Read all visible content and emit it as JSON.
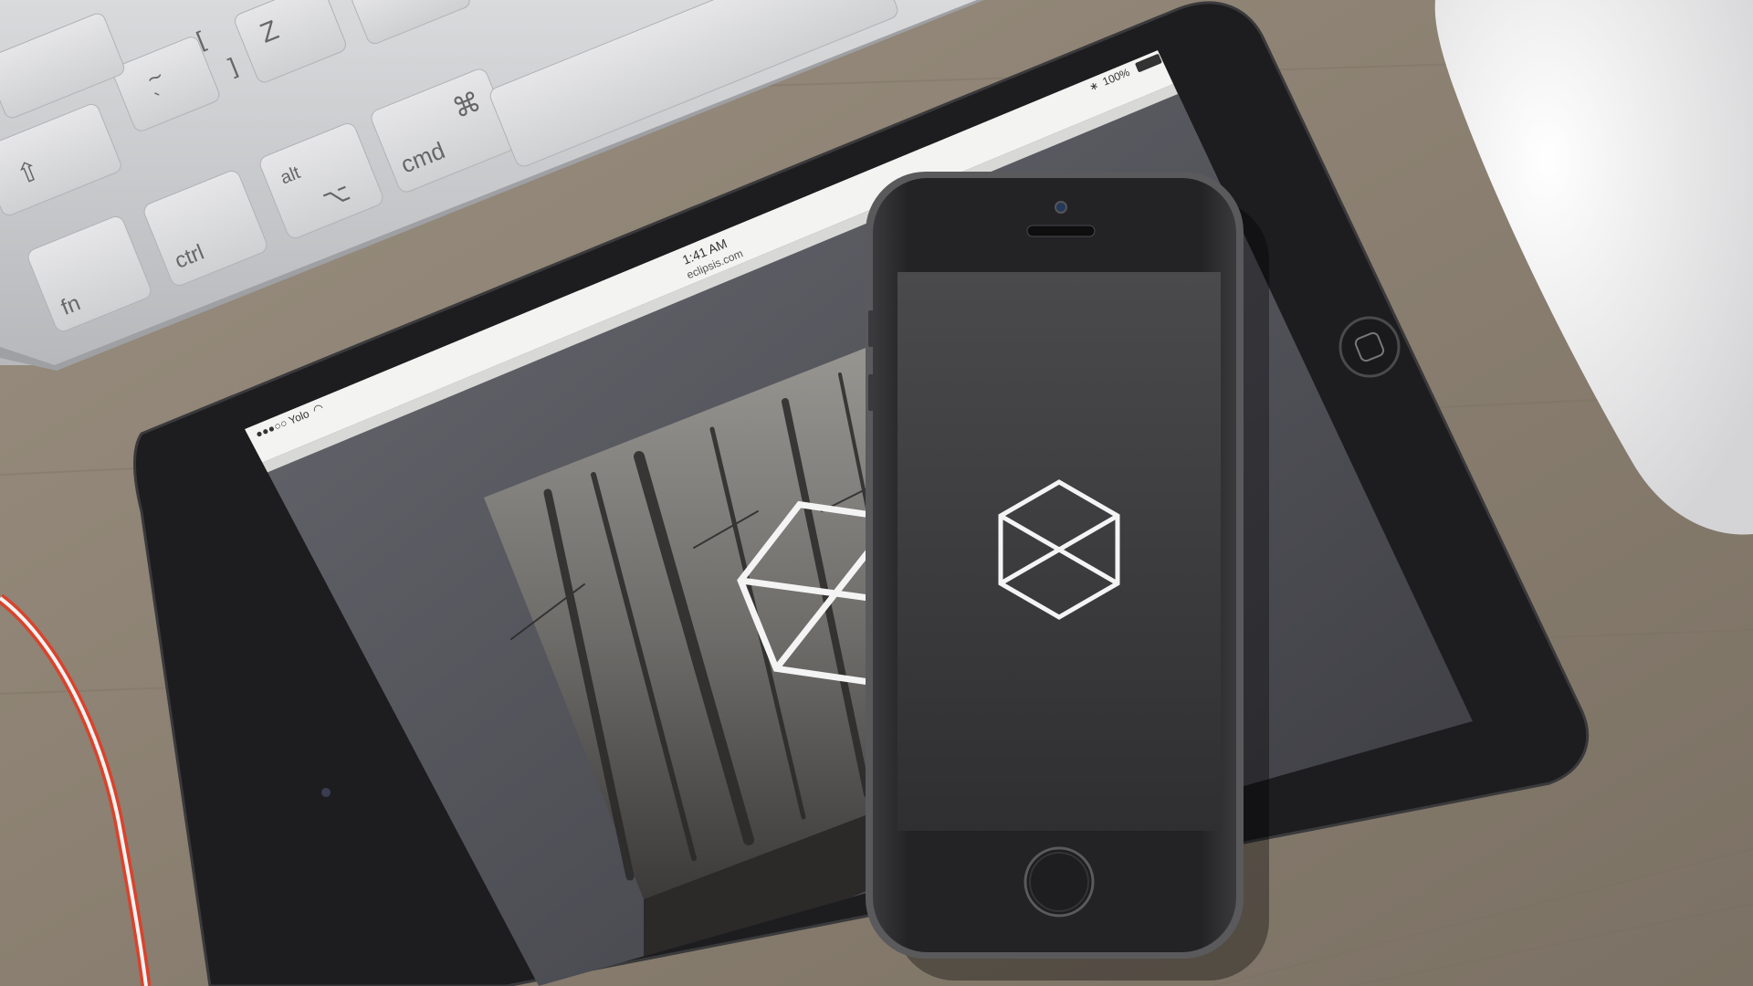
{
  "colors": {
    "desk": "#8e8272",
    "desk_dark": "#6f655a",
    "keyboard_body": "#c9cacc",
    "key_cap": "#dcdcde",
    "tablet_bezel": "#1f1f21",
    "tablet_screen": "#54545b",
    "phone_body": "#262628",
    "phone_screen": "#414143",
    "status_bar": "#f1f1ef",
    "cable": "#e0452f",
    "mouse": "#eeeeee",
    "logo_stroke": "#f4f4f4"
  },
  "keyboard": {
    "keys": {
      "shift": "⇧",
      "fn": "fn",
      "ctrl": "ctrl",
      "alt_top": "alt",
      "alt_bottom": "⌥",
      "cmd_label": "cmd",
      "cmd_symbol": "⌘",
      "tilde_top": "~",
      "tilde_bottom": "`",
      "z": "Z",
      "bracket_open": "[",
      "bracket_close": "]"
    }
  },
  "tablet": {
    "status_bar": {
      "carrier": "●●●○○ Yolo",
      "wifi_icon": "wifi-icon",
      "bluetooth": "∗",
      "battery_percent": "100%"
    },
    "address_bar": {
      "time": "1:41 AM",
      "url": "eclipsis.com"
    },
    "hero": {
      "image": "foggy-forest-photo",
      "logo": "hexagon-cross-logo-icon"
    }
  },
  "phone": {
    "screen": {
      "logo": "hexagon-cross-logo-icon"
    },
    "home_button_icon": "home-button-icon"
  },
  "mouse": {
    "icon": "mouse-icon"
  }
}
